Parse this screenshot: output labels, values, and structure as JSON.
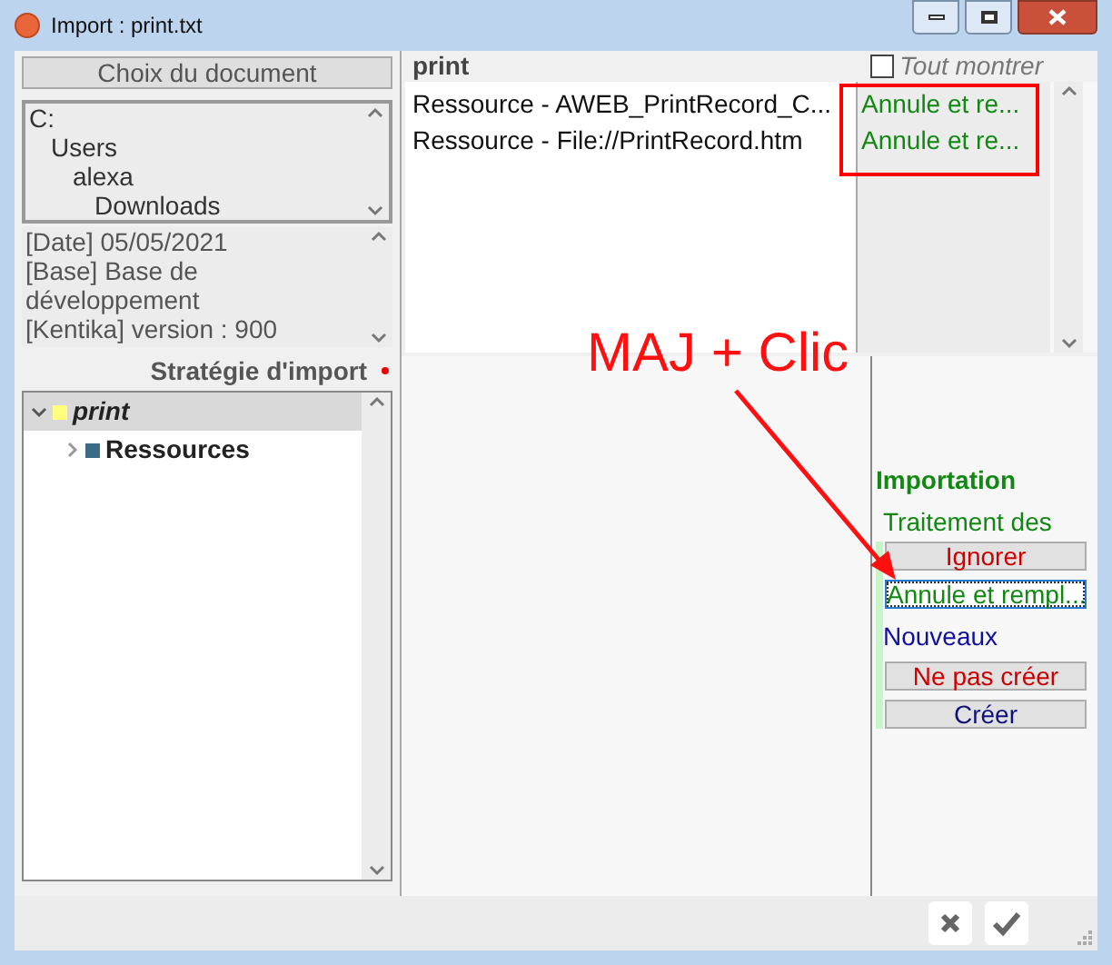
{
  "window": {
    "title": "Import : print.txt"
  },
  "document_button": "Choix du document",
  "path_tree": [
    {
      "label": "C:",
      "children": [
        {
          "label": "Users",
          "children": [
            {
              "label": "alexa",
              "children": [
                {
                  "label": "Downloads"
                }
              ]
            }
          ]
        }
      ]
    }
  ],
  "info_lines": [
    "[Date] 05/05/2021",
    "[Base] Base de développement",
    "[Kentika] version : 900"
  ],
  "strategy_label": "Stratégie d'import",
  "tree": [
    {
      "label": "print",
      "expanded": true,
      "selected": true,
      "color": "#ffff80",
      "children": [
        {
          "label": "Ressources",
          "expanded": false,
          "selected": false,
          "color": "#3b6b86"
        }
      ]
    }
  ],
  "list": {
    "title": "print",
    "show_all": {
      "label": "Tout montrer",
      "checked": false
    },
    "rows": [
      {
        "name": "Ressource - AWEB_PrintRecord_C...",
        "action": "Annule et re..."
      },
      {
        "name": "Ressource - File://PrintRecord.htm",
        "action": "Annule et re..."
      }
    ]
  },
  "importation": {
    "title": "Importation",
    "groups": [
      {
        "label": "Traitement des",
        "kind": "existing",
        "buttons": [
          {
            "label": "Ignorer",
            "kind": "skip",
            "focused": false
          },
          {
            "label": "Annule et rempl...",
            "kind": "replace",
            "focused": true
          }
        ]
      },
      {
        "label": "Nouveaux",
        "kind": "new",
        "buttons": [
          {
            "label": "Ne pas créer",
            "kind": "skip",
            "focused": false
          },
          {
            "label": "Créer",
            "kind": "create",
            "focused": false
          }
        ]
      }
    ]
  },
  "annotation": {
    "text": "MAJ + Clic"
  }
}
